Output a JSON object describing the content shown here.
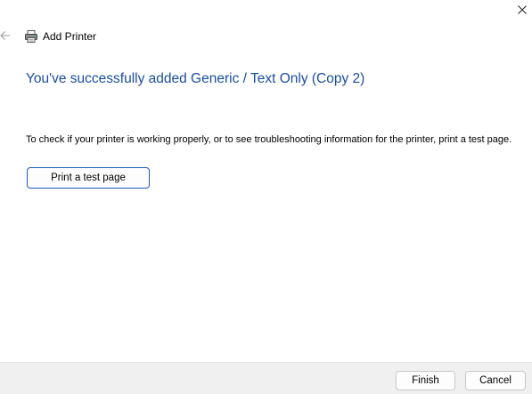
{
  "window": {
    "close_icon": "close-icon"
  },
  "header": {
    "back_icon": "back-arrow-icon",
    "printer_icon": "printer-icon",
    "title": "Add Printer"
  },
  "main": {
    "heading": "You've successfully added Generic / Text Only (Copy 2)",
    "info_text": "To check if your printer is working properly, or to see troubleshooting information for the printer, print a test page.",
    "test_page_button": "Print a test page"
  },
  "footer": {
    "finish_label": "Finish",
    "cancel_label": "Cancel"
  },
  "colors": {
    "heading": "#1a4ea0",
    "footer_background": "#f0f0f0",
    "primary_button_border": "#1a5bb0"
  }
}
